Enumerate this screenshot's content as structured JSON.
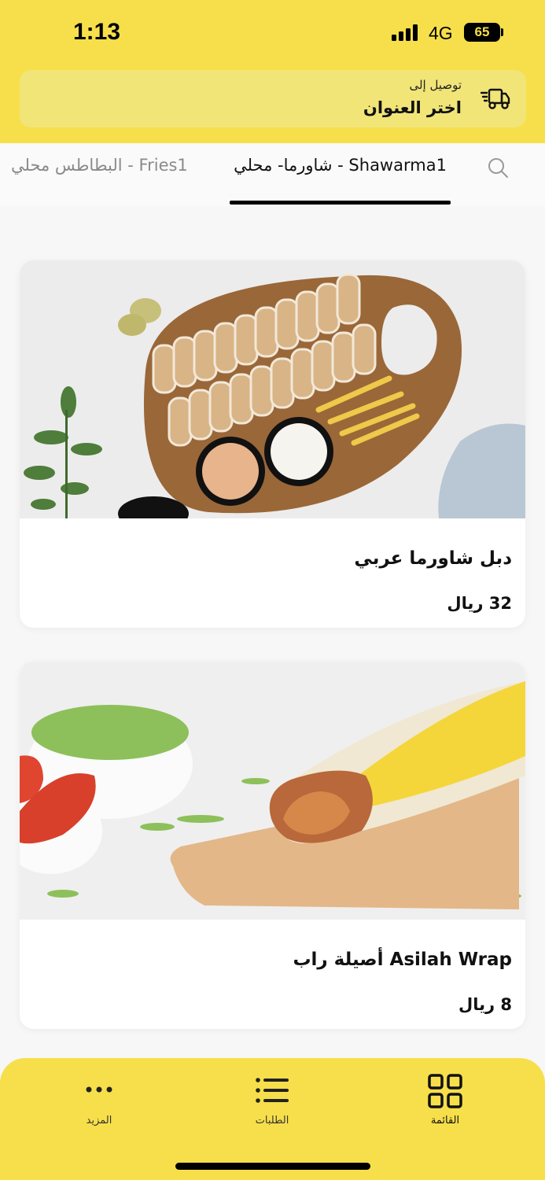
{
  "status_bar": {
    "time": "1:13",
    "network": "4G",
    "battery": "65"
  },
  "address": {
    "delivery_label": "توصيل إلى",
    "choose_address": "اختر العنوان",
    "icon": "delivery-truck-icon"
  },
  "tabs": {
    "search_icon": "search-icon",
    "items": [
      {
        "label": "شاورما- محلي - Shawarma1",
        "active": true
      },
      {
        "label": "البطاطس محلي - Fries1",
        "active": false
      }
    ]
  },
  "products": [
    {
      "name": "دبل شاورما عربي",
      "price": "32 ريال"
    },
    {
      "name": "أصيلة راب Asilah Wrap",
      "price": "8 ريال"
    }
  ],
  "bottom_nav": {
    "items": [
      {
        "label": "المزيد",
        "icon": "more-dots-icon"
      },
      {
        "label": "الطلبات",
        "icon": "orders-list-icon"
      },
      {
        "label": "القائمة",
        "icon": "menu-grid-icon"
      }
    ]
  },
  "colors": {
    "brand_yellow": "#f6df4a",
    "address_box": "#f1e578",
    "text": "#111111",
    "muted": "#8a8a8a"
  }
}
